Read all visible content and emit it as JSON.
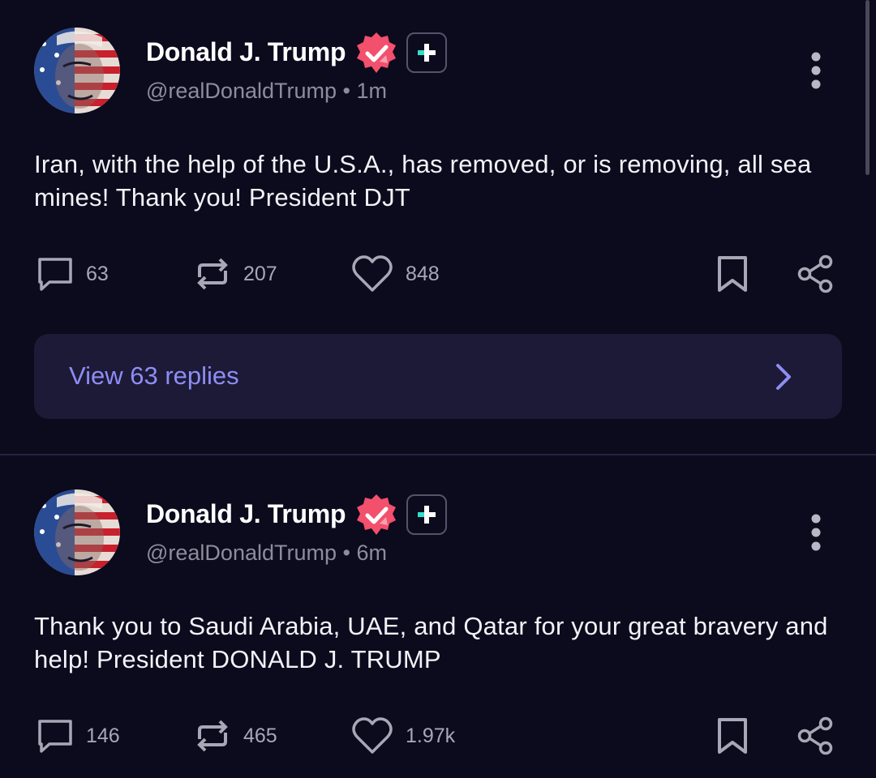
{
  "posts": [
    {
      "author": {
        "name": "Donald J. Trump",
        "handle": "@realDonaldTrump",
        "time": "1m"
      },
      "text": "Iran, with the help of the U.S.A., has removed, or is removing, all sea mines! Thank you! President DJT",
      "stats": {
        "replies": "63",
        "reposts": "207",
        "likes": "848"
      },
      "view_replies_label": "View 63 replies"
    },
    {
      "author": {
        "name": "Donald J. Trump",
        "handle": "@realDonaldTrump",
        "time": "6m"
      },
      "text": "Thank you to Saudi Arabia, UAE, and Qatar for your great bravery and help! President DONALD J. TRUMP",
      "stats": {
        "replies": "146",
        "reposts": "465",
        "likes": "1.97k"
      }
    }
  ],
  "icons": {
    "avatar": "profile-picture",
    "verified": "verified-badge-icon",
    "plus": "plus-badge-icon",
    "more": "more-vertical-icon",
    "reply": "comment-icon",
    "repost": "repost-icon",
    "like": "heart-icon",
    "bookmark": "bookmark-icon",
    "share": "share-icon",
    "chevron": "chevron-right-icon"
  },
  "colors": {
    "background": "#0c0a1d",
    "card": "#1c1a36",
    "link": "#8e8df4",
    "verified": "#f2506c",
    "plus_accent": "#2fe0c8",
    "muted": "#8e8c9c"
  }
}
